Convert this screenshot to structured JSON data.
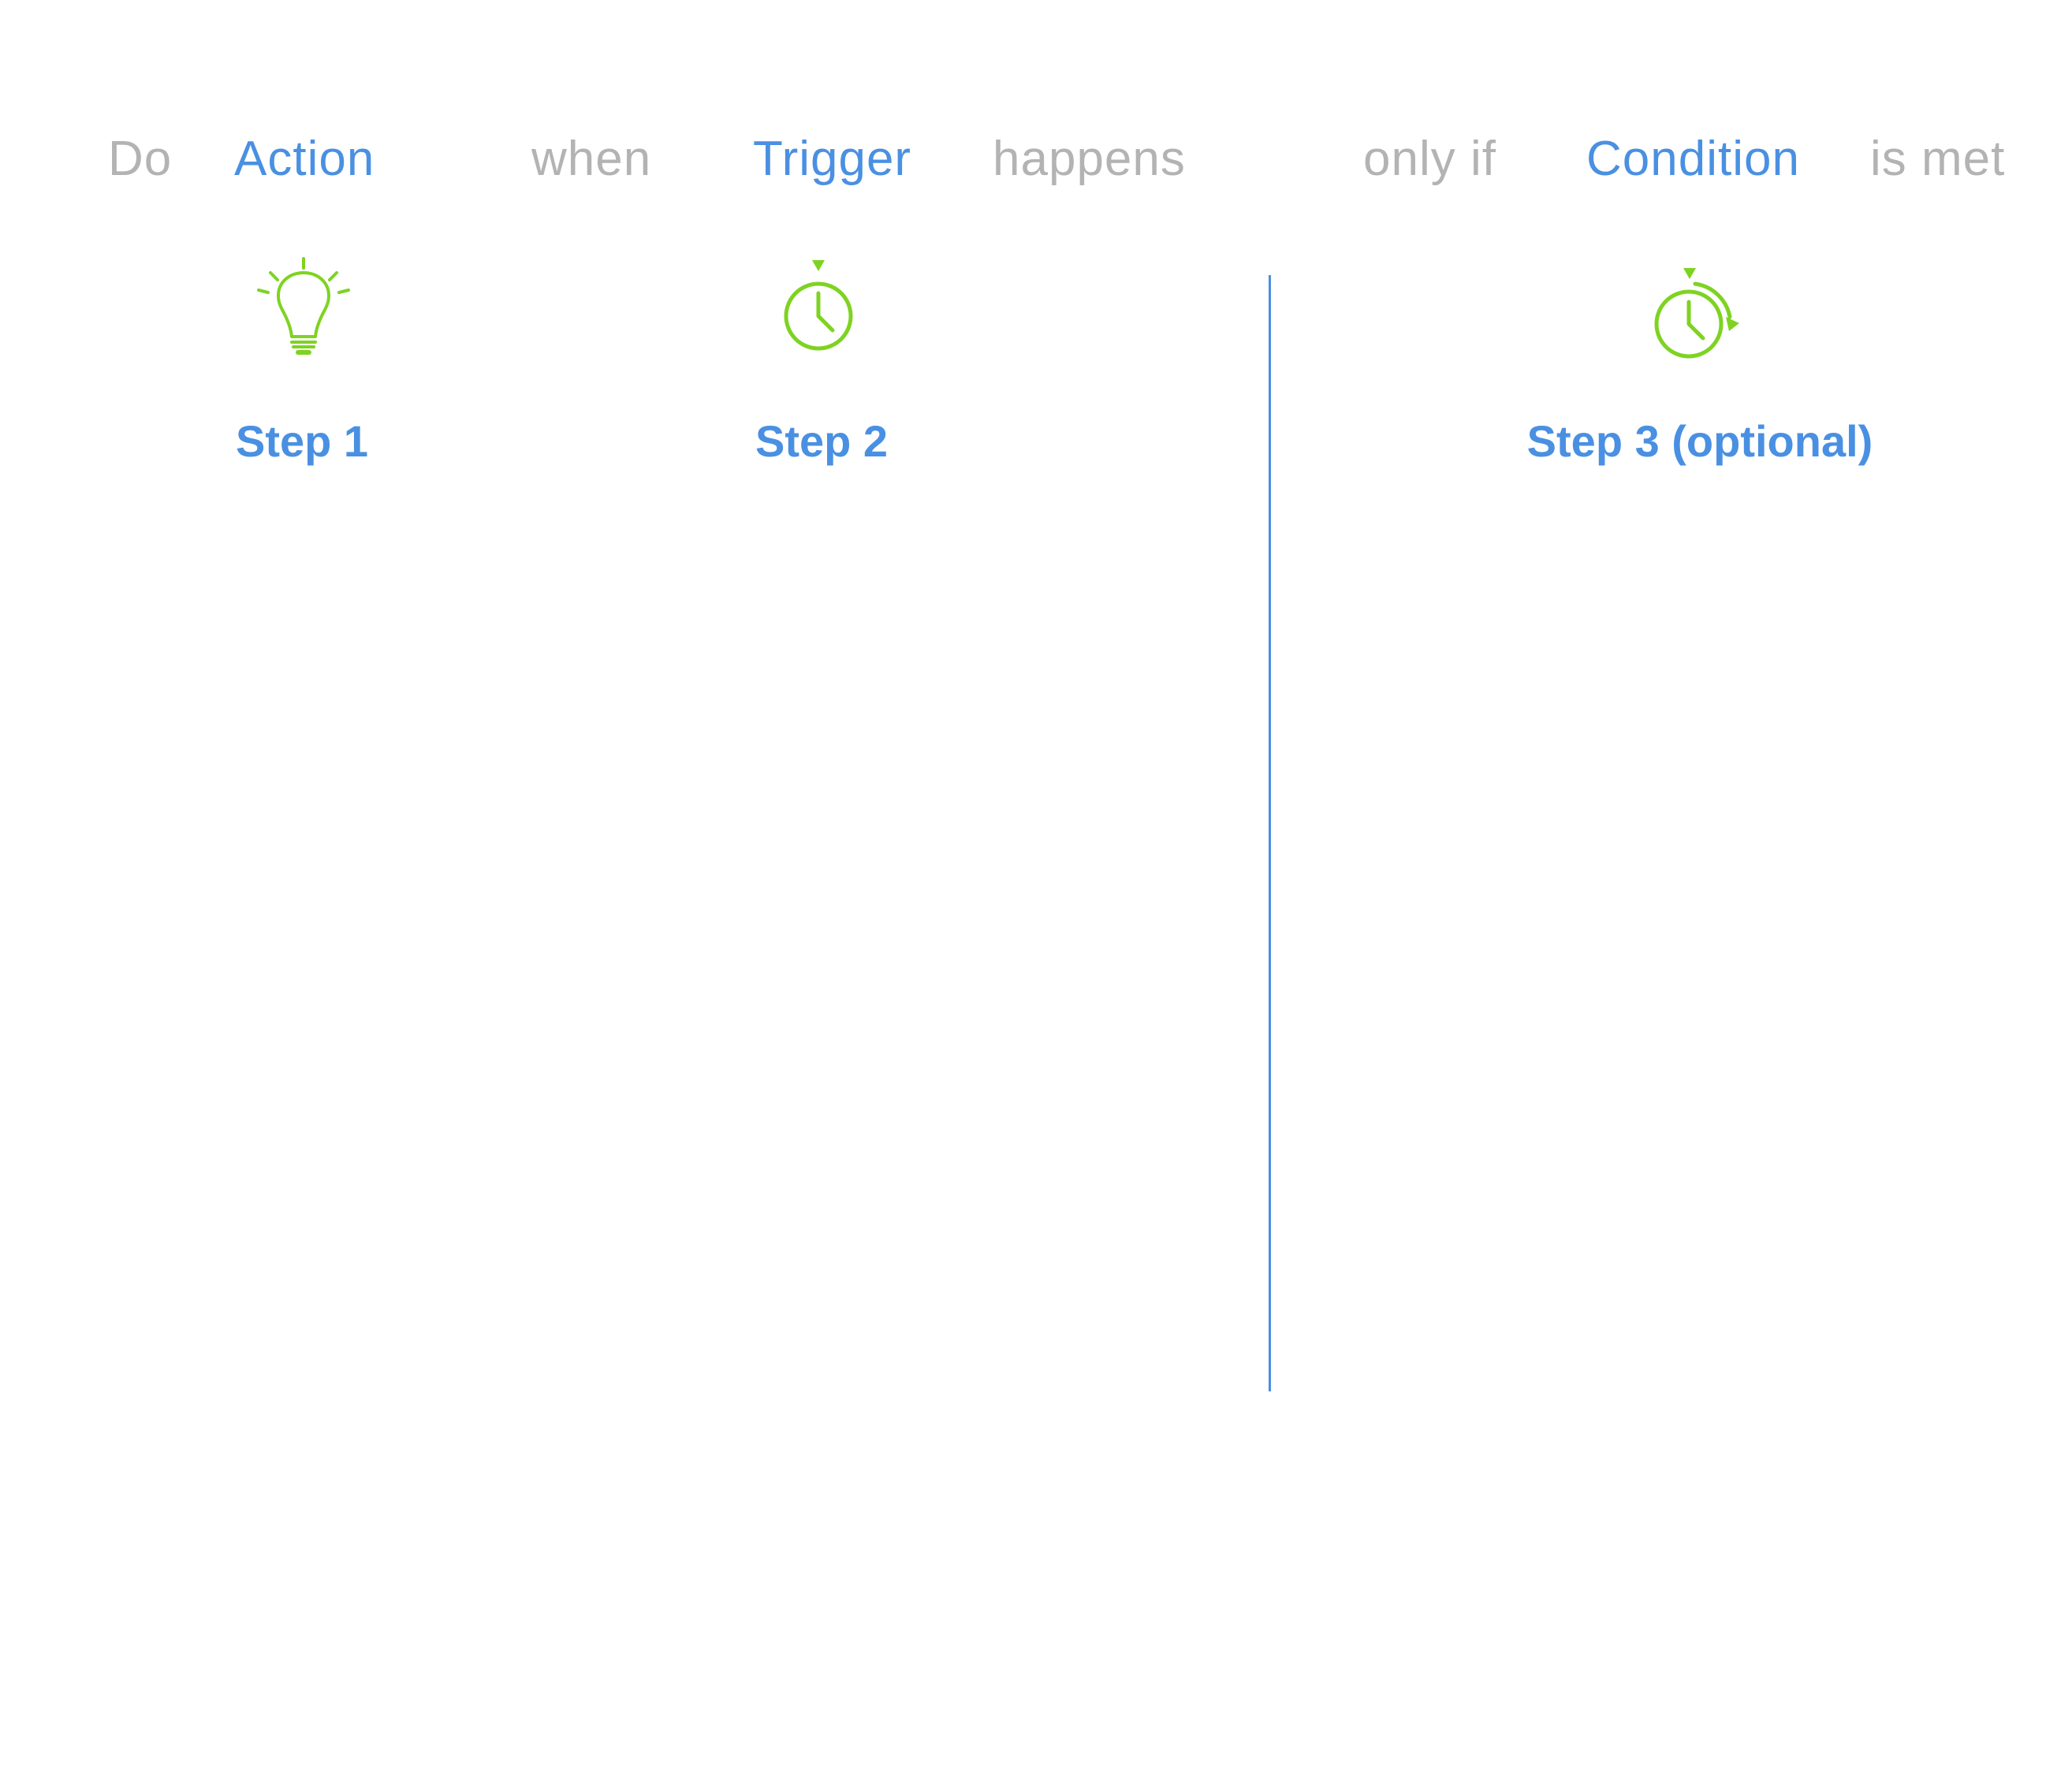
{
  "sentence": {
    "do": "Do",
    "action": "Action",
    "when": "when",
    "trigger": "Trigger",
    "happens": "happens",
    "only_if": "only if",
    "condition": "Condition",
    "is_met": "is met"
  },
  "steps": [
    {
      "label": "Step 1",
      "icon": "lightbulb-icon"
    },
    {
      "label": "Step 2",
      "icon": "stopwatch-icon"
    },
    {
      "label": "Step 3 (optional)",
      "icon": "timer-cycle-icon"
    }
  ],
  "colors": {
    "accent": "#4a90e2",
    "muted": "#b3b3b3",
    "icon": "#7ed321"
  }
}
